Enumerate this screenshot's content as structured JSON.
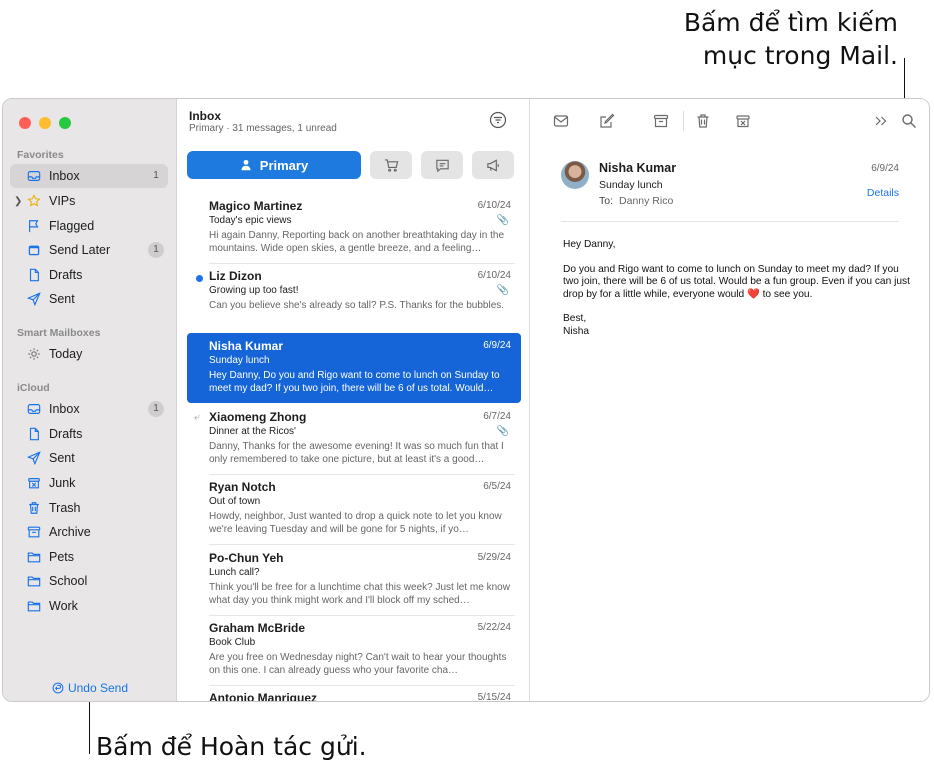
{
  "callouts": {
    "search_line1": "Bấm để tìm kiếm",
    "search_line2": "mục trong Mail.",
    "undo_send": "Bấm để Hoàn tác gửi."
  },
  "colors": {
    "accent": "#1f7ae0",
    "selected_row": "#1565d8",
    "close": "#ff5f57",
    "minimize": "#febc2e",
    "zoom": "#28c840"
  },
  "sidebar": {
    "favorites_header": "Favorites",
    "favorites": [
      {
        "label": "Inbox",
        "icon": "inbox-icon",
        "badge": "1"
      },
      {
        "label": "VIPs",
        "icon": "star-icon",
        "badge": ""
      },
      {
        "label": "Flagged",
        "icon": "flag-icon",
        "badge": ""
      },
      {
        "label": "Send Later",
        "icon": "calendar-icon",
        "badge": "1"
      },
      {
        "label": "Drafts",
        "icon": "document-icon",
        "badge": ""
      },
      {
        "label": "Sent",
        "icon": "paperplane-icon",
        "badge": ""
      }
    ],
    "smart_header": "Smart Mailboxes",
    "smart": [
      {
        "label": "Today",
        "icon": "gear-icon"
      }
    ],
    "icloud_header": "iCloud",
    "icloud": [
      {
        "label": "Inbox",
        "icon": "inbox-icon",
        "badge": "1"
      },
      {
        "label": "Drafts",
        "icon": "document-icon"
      },
      {
        "label": "Sent",
        "icon": "paperplane-icon"
      },
      {
        "label": "Junk",
        "icon": "junk-icon"
      },
      {
        "label": "Trash",
        "icon": "trash-icon"
      },
      {
        "label": "Archive",
        "icon": "archive-icon"
      },
      {
        "label": "Pets",
        "icon": "folder-icon"
      },
      {
        "label": "School",
        "icon": "folder-icon"
      },
      {
        "label": "Work",
        "icon": "folder-icon"
      }
    ],
    "undo_send": "Undo Send"
  },
  "list": {
    "title": "Inbox",
    "subtitle": "Primary · 31 messages, 1 unread",
    "primary_tab": "Primary",
    "messages": [
      {
        "from": "Magico Martinez",
        "date": "6/10/24",
        "subject": "Today's epic views",
        "preview": "Hi again Danny, Reporting back on another breathtaking day in the mountains. Wide open skies, a gentle breeze, and a feeling…"
      },
      {
        "from": "Liz Dizon",
        "date": "6/10/24",
        "subject": "Growing up too fast!",
        "preview": "Can you believe she's already so tall? P.S. Thanks for the bubbles."
      },
      {
        "from": "Nisha Kumar",
        "date": "6/9/24",
        "subject": "Sunday lunch",
        "preview": "Hey Danny, Do you and Rigo want to come to lunch on Sunday to meet my dad? If you two join, there will be 6 of us total. Would…"
      },
      {
        "from": "Xiaomeng Zhong",
        "date": "6/7/24",
        "subject": "Dinner at the Ricos'",
        "preview": "Danny, Thanks for the awesome evening! It was so much fun that I only remembered to take one picture, but at least it's a good…"
      },
      {
        "from": "Ryan Notch",
        "date": "6/5/24",
        "subject": "Out of town",
        "preview": "Howdy, neighbor, Just wanted to drop a quick note to let you know we're leaving Tuesday and will be gone for 5 nights, if yo…"
      },
      {
        "from": "Po-Chun Yeh",
        "date": "5/29/24",
        "subject": "Lunch call?",
        "preview": "Think you'll be free for a lunchtime chat this week? Just let me know what day you think might work and I'll block off my sched…"
      },
      {
        "from": "Graham McBride",
        "date": "5/22/24",
        "subject": "Book Club",
        "preview": "Are you free on Wednesday night? Can't wait to hear your thoughts on this one. I can already guess who your favorite cha…"
      },
      {
        "from": "Antonio Manriquez",
        "date": "5/15/24",
        "subject": "",
        "preview": ""
      }
    ]
  },
  "reader": {
    "from": "Nisha Kumar",
    "date": "6/9/24",
    "subject": "Sunday lunch",
    "to_label": "To:",
    "to_name": "Danny Rico",
    "details": "Details",
    "greeting": "Hey Danny,",
    "body_before_heart": "Do you and Rigo want to come to lunch on Sunday to meet my dad? If you two join, there will be 6 of us total. Would be a fun group. Even if you can just drop by for a little while, everyone would",
    "heart": "❤️",
    "body_after_heart": "to see you.",
    "signoff": "Best,",
    "signature": "Nisha"
  }
}
